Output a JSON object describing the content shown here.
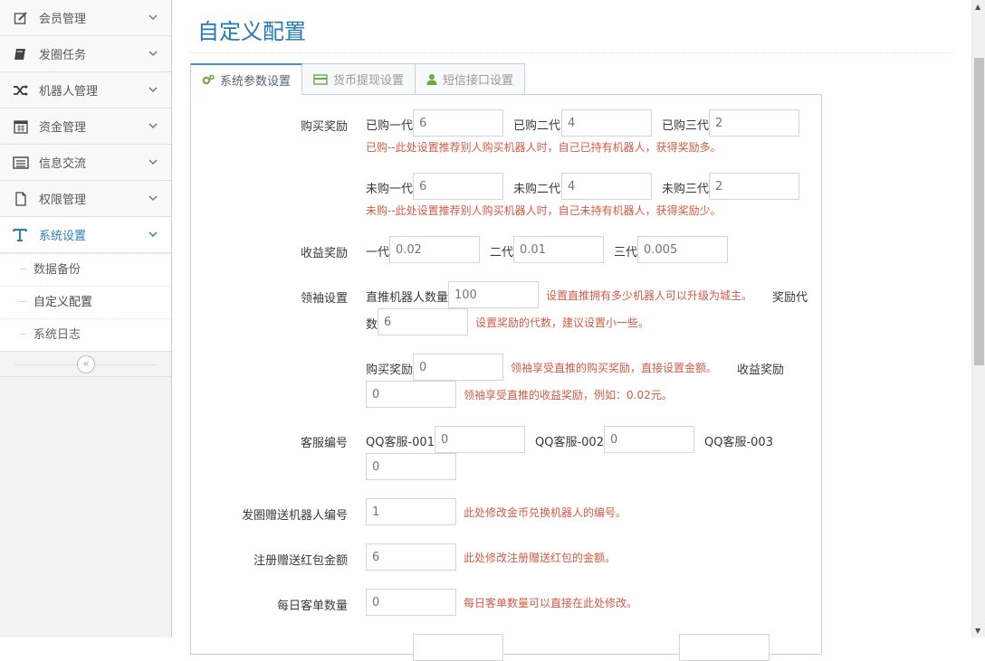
{
  "sidebar": {
    "items": [
      {
        "label": "会员管理",
        "icon": "edit-icon"
      },
      {
        "label": "发圈任务",
        "icon": "book-icon"
      },
      {
        "label": "机器人管理",
        "icon": "shuffle-icon"
      },
      {
        "label": "资金管理",
        "icon": "calendar-icon"
      },
      {
        "label": "信息交流",
        "icon": "list-alt-icon"
      },
      {
        "label": "权限管理",
        "icon": "file-icon"
      },
      {
        "label": "系统设置",
        "icon": "text-icon"
      }
    ],
    "submenu": [
      "数据备份",
      "自定义配置",
      "系统日志"
    ],
    "collapse_glyph": "«"
  },
  "page": {
    "title": "自定义配置",
    "tabs": [
      {
        "label": "系统参数设置",
        "icon": "cogs-icon"
      },
      {
        "label": "货币提现设置",
        "icon": "credit-card-icon"
      },
      {
        "label": "短信接口设置",
        "icon": "user-icon"
      }
    ]
  },
  "form": {
    "purchase_reward": {
      "label": "购买奖励",
      "bought_l1_label": "已购一代",
      "bought_l1": "6",
      "bought_l2_label": "已购二代",
      "bought_l2": "4",
      "bought_l3_label": "已购三代",
      "bought_l3": "2",
      "bought_hint": "已购--此处设置推荐别人购买机器人时，自己已持有机器人，获得奖励多。",
      "notbought_l1_label": "未购一代",
      "notbought_l1": "6",
      "notbought_l2_label": "未购二代",
      "notbought_l2": "4",
      "notbought_l3_label": "未购三代",
      "notbought_l3": "2",
      "notbought_hint": "未购--此处设置推荐别人购买机器人时，自己未持有机器人，获得奖励少。"
    },
    "income_reward": {
      "label": "收益奖励",
      "l1_label": "一代",
      "l1": "0.02",
      "l2_label": "二代",
      "l2": "0.01",
      "l3_label": "三代",
      "l3": "0.005"
    },
    "leader": {
      "label": "领袖设置",
      "direct_label": "直推机器人数量",
      "direct": "100",
      "direct_hint": "设置直推拥有多少机器人可以升级为城主。",
      "gen_label_a": "奖励代",
      "gen_label_b": "数",
      "gen": "6",
      "gen_hint": "设置奖励的代数，建议设置小一些。",
      "buy_label": "购买奖励",
      "buy": "0",
      "buy_hint": "领袖享受直推的购买奖励，直接设置金额。",
      "income_label": "收益奖励",
      "income": "0",
      "income_hint": "领袖享受直推的收益奖励，例如：0.02元。"
    },
    "service": {
      "label": "客服编号",
      "s1_label": "QQ客服-001",
      "s1": "0",
      "s2_label": "QQ客服-002",
      "s2": "0",
      "s3_label": "QQ客服-003",
      "s3": "0"
    },
    "robot_gift": {
      "label": "发圈赠送机器人编号",
      "value": "1",
      "hint": "此处修改金币兑换机器人的编号。"
    },
    "register_gift": {
      "label": "注册赠送红包金额",
      "value": "6",
      "hint": "此处修改注册赠送红包的金额。"
    },
    "daily_orders": {
      "label": "每日客单数量",
      "value": "0",
      "hint": "每日客单数量可以直接在此处修改。"
    }
  },
  "colors": {
    "accent": "#2679b5",
    "hint": "#d15b47",
    "tab_border": "#c5d0dc"
  }
}
